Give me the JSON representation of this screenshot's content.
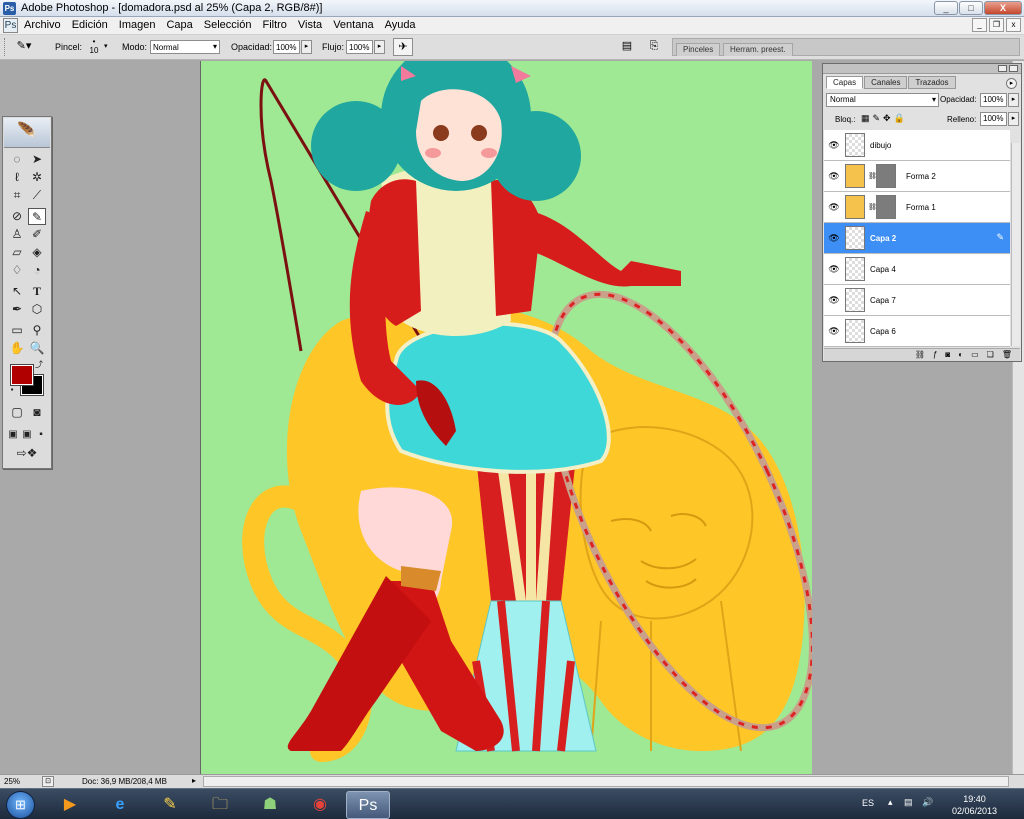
{
  "window": {
    "title": "Adobe Photoshop - [domadora.psd al 25% (Capa 2, RGB/8#)]",
    "minimize_icon": "minimize-icon",
    "maximize_icon": "maximize-icon",
    "close_icon": "close-icon"
  },
  "menu": {
    "items": [
      "Archivo",
      "Edición",
      "Imagen",
      "Capa",
      "Selección",
      "Filtro",
      "Vista",
      "Ventana",
      "Ayuda"
    ]
  },
  "options": {
    "pincel_label": "Pincel:",
    "brush_size": "10",
    "modo_label": "Modo:",
    "modo_value": "Normal",
    "opacidad_label": "Opacidad:",
    "opacidad_value": "100%",
    "flujo_label": "Flujo:",
    "flujo_value": "100%",
    "palette_tabs": [
      "Pinceles",
      "Herram. preest."
    ]
  },
  "toolbox": {
    "tools": [
      "marquee-icon",
      "move-icon",
      "lasso-icon",
      "magic-wand-icon",
      "crop-icon",
      "slice-icon",
      "healing-brush-icon",
      "brush-icon",
      "clone-stamp-icon",
      "history-brush-icon",
      "eraser-icon",
      "paint-bucket-icon",
      "blur-icon",
      "dodge-icon",
      "path-selection-icon",
      "type-icon",
      "pen-icon",
      "shape-icon",
      "notes-icon",
      "eyedropper-icon",
      "hand-icon",
      "zoom-icon"
    ],
    "foreground_color": "#b00000",
    "background_color": "#000000"
  },
  "layers_panel": {
    "tabs": [
      "Capas",
      "Canales",
      "Trazados"
    ],
    "blend_mode": "Normal",
    "opacidad_label": "Opacidad:",
    "opacidad_value": "100%",
    "bloq_label": "Bloq.:",
    "relleno_label": "Relleno:",
    "relleno_value": "100%",
    "layers": [
      {
        "name": "dibujo",
        "visible": true,
        "active": false
      },
      {
        "name": "Forma 2",
        "visible": true,
        "active": false
      },
      {
        "name": "Forma 1",
        "visible": true,
        "active": false
      },
      {
        "name": "Capa 2",
        "visible": true,
        "active": true
      },
      {
        "name": "Capa 4",
        "visible": true,
        "active": false
      },
      {
        "name": "Capa 7",
        "visible": true,
        "active": false
      },
      {
        "name": "Capa 6",
        "visible": true,
        "active": false
      }
    ]
  },
  "status": {
    "zoom": "25%",
    "doc": "Doc: 36,9 MB/208,4 MB"
  },
  "canvas": {
    "background_color": "#9fe894",
    "illustration": "circus-tamer-girl-with-lion-and-hoop"
  },
  "taskbar": {
    "apps": [
      "media-player-icon",
      "internet-explorer-icon",
      "paint-icon",
      "file-explorer-icon",
      "network-icon",
      "chrome-icon",
      "photoshop-icon"
    ],
    "lang": "ES",
    "time": "19:40",
    "date": "02/06/2013"
  }
}
